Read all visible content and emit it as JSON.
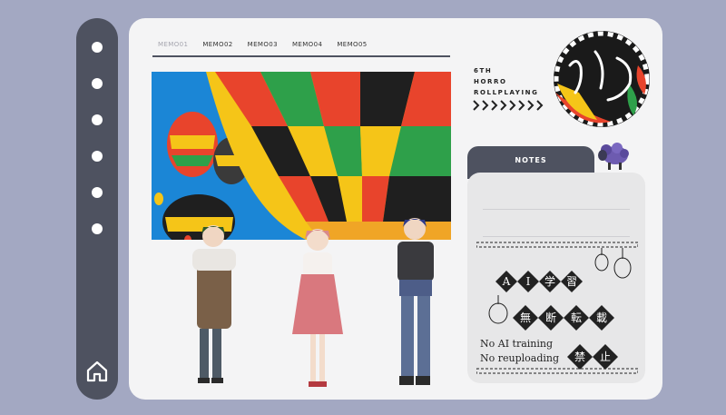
{
  "tabs": [
    {
      "label": "MEMO01",
      "active": true
    },
    {
      "label": "MEMO02",
      "active": false
    },
    {
      "label": "MEMO03",
      "active": false
    },
    {
      "label": "MEMO04",
      "active": false
    },
    {
      "label": "MEMO05",
      "active": false
    }
  ],
  "header": {
    "title_line1": "6TH",
    "title_line2": "HORRO",
    "title_line3": "ROLLPLAYING",
    "arrow_count": 8
  },
  "badge": {
    "text": "めめ"
  },
  "notes": {
    "label": "NOTES"
  },
  "watermark": {
    "kanji1": [
      "A",
      "I",
      "学",
      "習"
    ],
    "kanji2": [
      "無",
      "断",
      "転",
      "載"
    ],
    "kanji3": [
      "禁",
      "止"
    ],
    "line1": "No AI training",
    "line2": "No reuploading"
  },
  "sidebar": {
    "dot_count": 6
  },
  "colors": {
    "sidebar": "#4e5260",
    "background": "#a3a8c2",
    "card": "#f4f4f5"
  }
}
